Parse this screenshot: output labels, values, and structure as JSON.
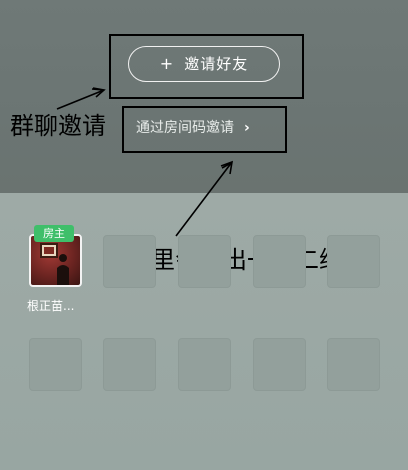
{
  "invite": {
    "plus": "+",
    "label": "邀请好友"
  },
  "room_code": {
    "label": "通过房间码邀请",
    "chevron": "›"
  },
  "annotations": {
    "left": "群聊邀请",
    "right": "点这里会生出一个二维码"
  },
  "members": [
    {
      "name": "根正苗...",
      "badge": "房主"
    }
  ],
  "colors": {
    "host_badge": "#3fbf6a",
    "top_panel": "#6f7977",
    "bottom_panel": "#9eaaa6"
  }
}
